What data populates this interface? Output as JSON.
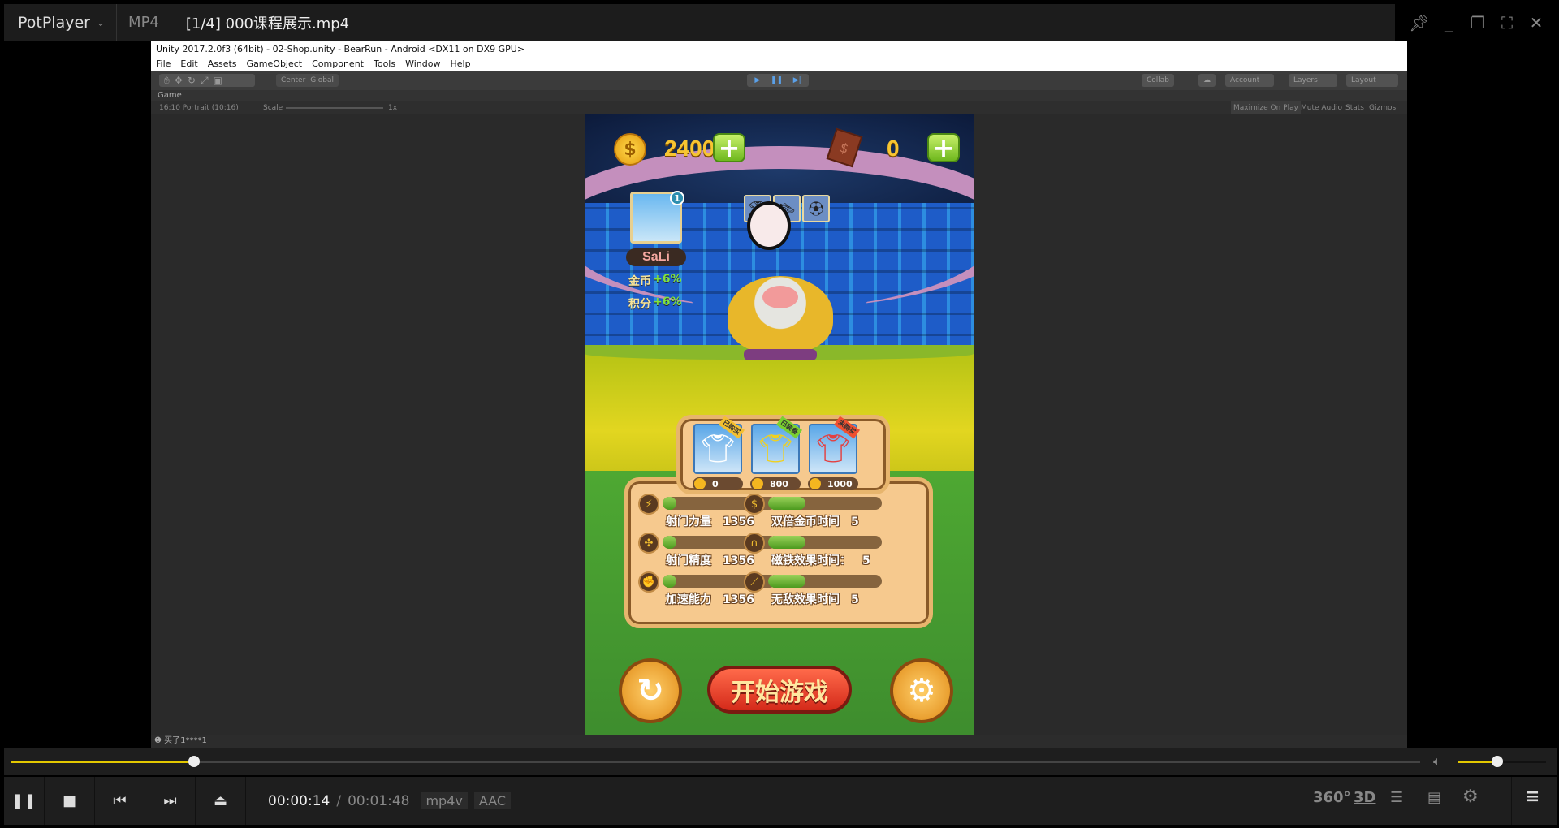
{
  "player": {
    "app_name": "PotPlayer",
    "format": "MP4",
    "title": "[1/4] 000课程展示.mp4",
    "window_icons": [
      "pin-icon",
      "minimize-icon",
      "restore-icon",
      "fullscreen-icon",
      "close-icon"
    ]
  },
  "unity": {
    "title": "Unity 2017.2.0f3 (64bit) - 02-Shop.unity - BearRun - Android <DX11 on DX9 GPU>",
    "menu": [
      "File",
      "Edit",
      "Assets",
      "GameObject",
      "Component",
      "Tools",
      "Window",
      "Help"
    ],
    "toolbar": {
      "center": "Center",
      "global": "Global",
      "collab": "Collab",
      "account": "Account",
      "layers": "Layers",
      "layout": "Layout"
    },
    "game_tab": "Game",
    "aspect": "16:10 Portrait (10:16)",
    "scale_label": "Scale",
    "scale_value": "1x",
    "view_options": [
      "Maximize On Play",
      "Mute Audio",
      "Stats",
      "Gizmos"
    ],
    "status": "买了1****1"
  },
  "game": {
    "coins": "2400",
    "gems": "0",
    "character_name": "SaLi",
    "character_level": "1",
    "bonuses": [
      {
        "label": "金币",
        "value": "+6%"
      },
      {
        "label": "积分",
        "value": "+6%"
      }
    ],
    "shirts": [
      {
        "price": "0",
        "color": "#ffffff",
        "status": "已购买"
      },
      {
        "price": "800",
        "color": "#f0d020",
        "status": "已装备"
      },
      {
        "price": "1000",
        "color": "#e44040",
        "status": "未购买"
      }
    ],
    "stats": [
      {
        "label": "射门力量",
        "value": "1356",
        "level": 0.12,
        "icon": "lightning-icon"
      },
      {
        "label": "双倍金币时间",
        "value": "5",
        "level": 0.33,
        "icon": "coin-icon"
      },
      {
        "label": "射门精度",
        "value": "1356",
        "level": 0.12,
        "icon": "target-icon"
      },
      {
        "label": "磁铁效果时间：",
        "value": "5",
        "level": 0.33,
        "icon": "magnet-icon"
      },
      {
        "label": "加速能力",
        "value": "1356",
        "level": 0.12,
        "icon": "shoe-icon"
      },
      {
        "label": "无敌效果时间",
        "value": "5",
        "level": 0.33,
        "icon": "shield-icon"
      }
    ],
    "start_label": "开始游戏"
  },
  "playback": {
    "current": "00:00:14",
    "separator": "/",
    "total": "00:01:48",
    "progress": 0.13,
    "volume": 0.45,
    "video_codec": "mp4v",
    "audio_codec": "AAC",
    "right_buttons": {
      "vr": "360°",
      "stereo": "3D"
    },
    "accent": "#e3c800"
  }
}
